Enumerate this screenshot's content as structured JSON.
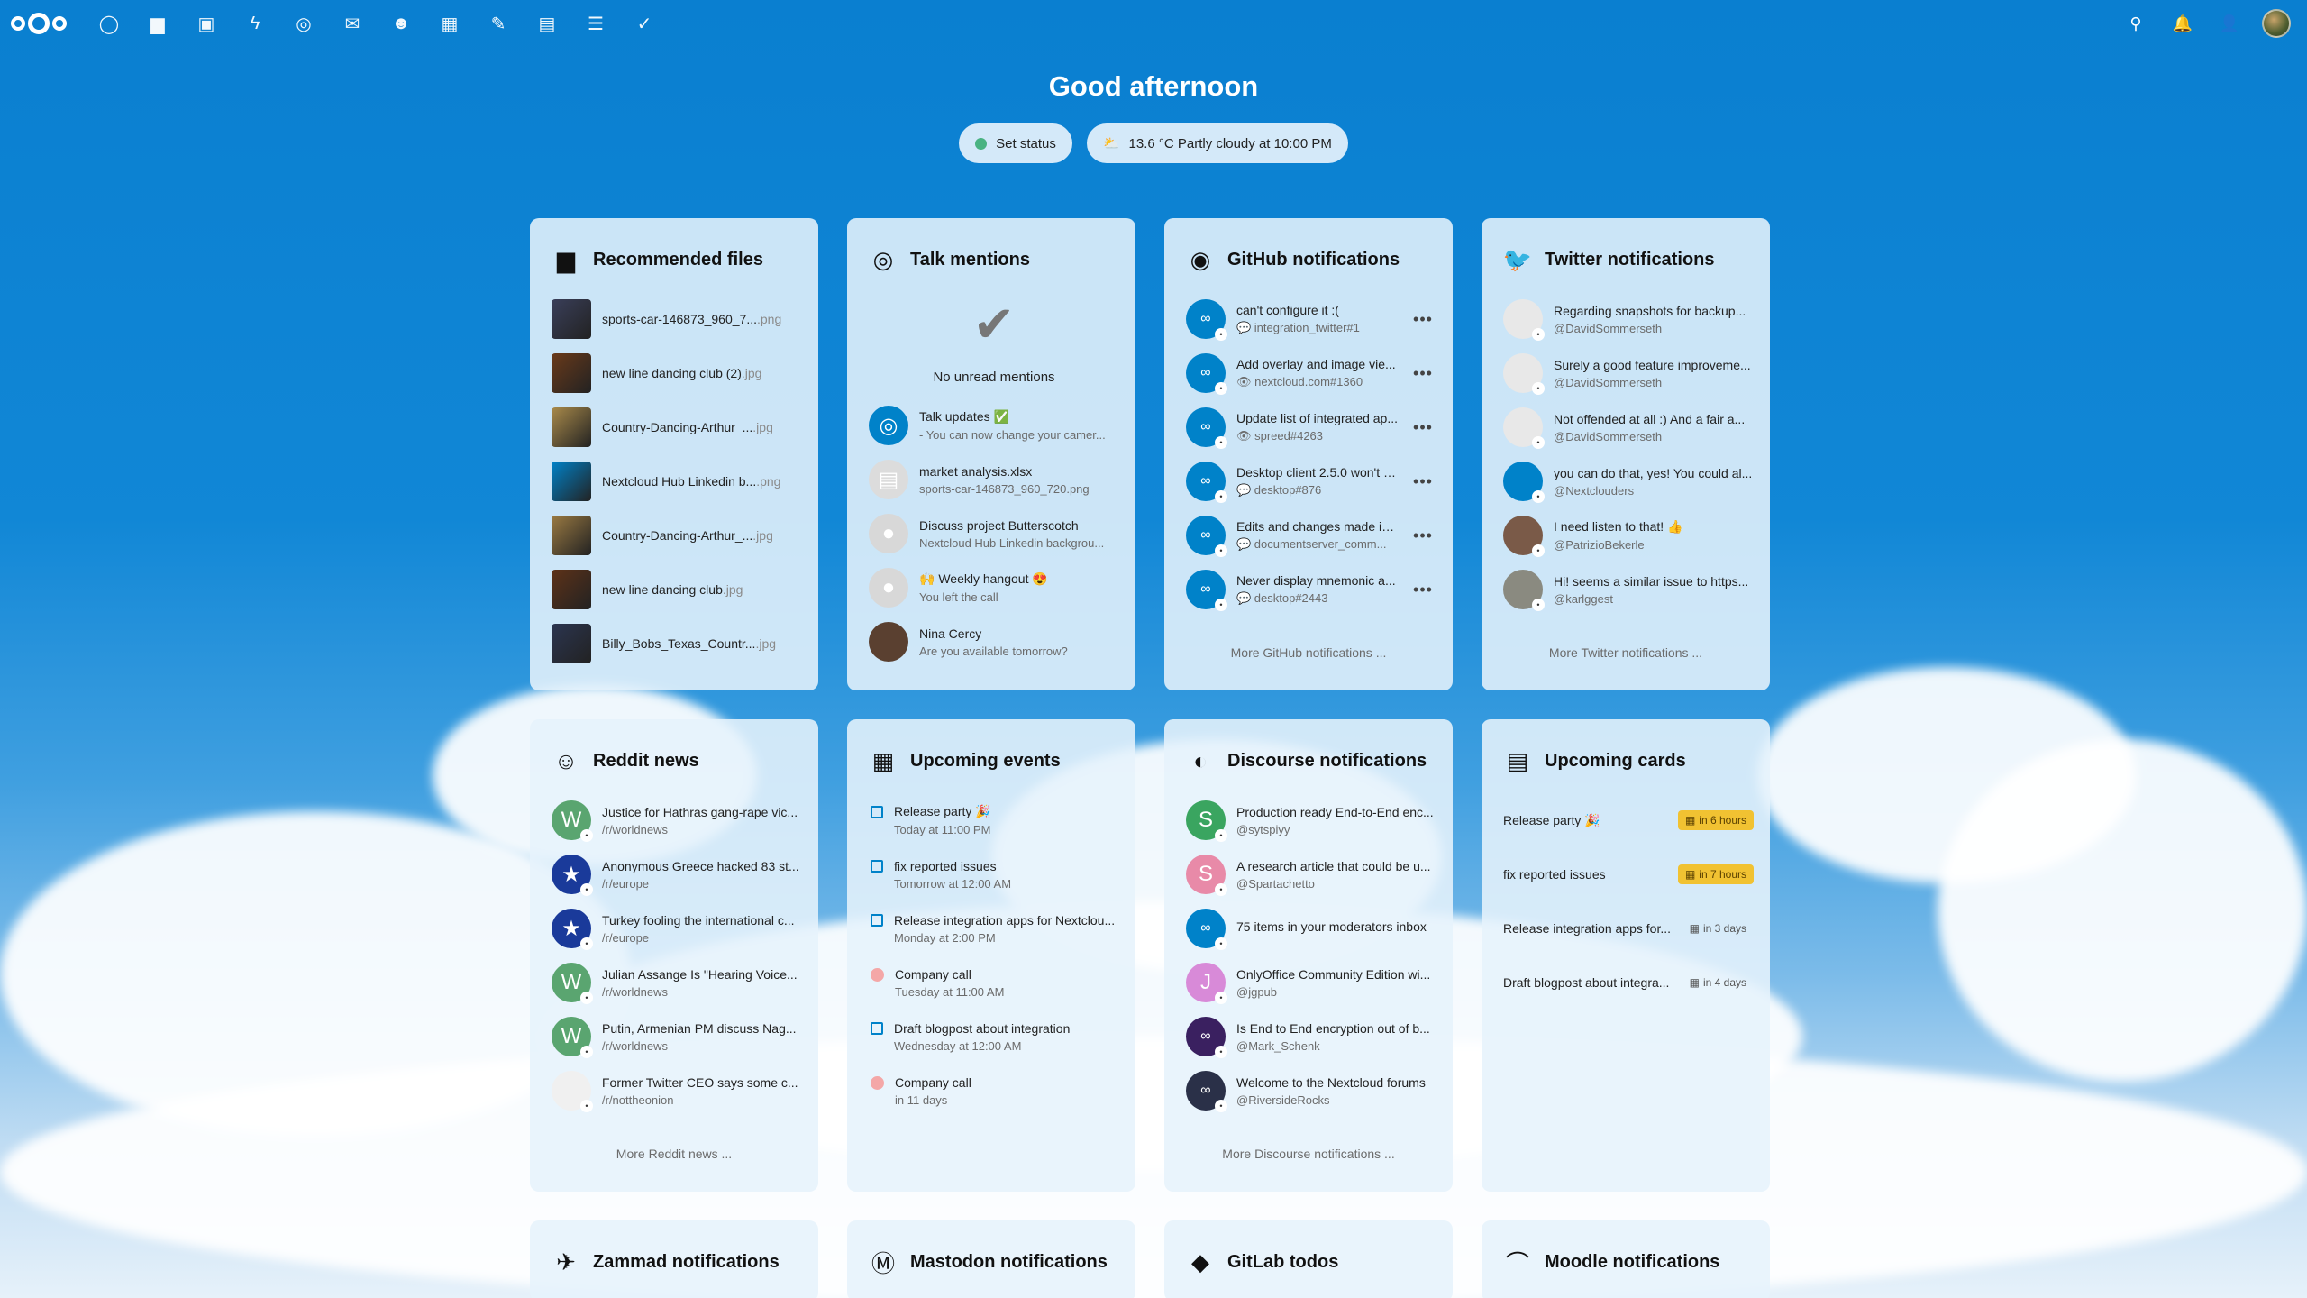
{
  "topbar": {
    "apps": [
      {
        "name": "dashboard-icon",
        "glyph": "◯"
      },
      {
        "name": "files-icon",
        "glyph": "▆"
      },
      {
        "name": "photos-icon",
        "glyph": "▣"
      },
      {
        "name": "activity-icon",
        "glyph": "ϟ"
      },
      {
        "name": "talk-icon",
        "glyph": "◎"
      },
      {
        "name": "mail-icon",
        "glyph": "✉"
      },
      {
        "name": "contacts-icon",
        "glyph": "☻"
      },
      {
        "name": "calendar-icon",
        "glyph": "▦"
      },
      {
        "name": "notes-icon",
        "glyph": "✎"
      },
      {
        "name": "deck-icon",
        "glyph": "▤"
      },
      {
        "name": "tasks-list-icon",
        "glyph": "☰"
      },
      {
        "name": "tasks-check-icon",
        "glyph": "✓"
      }
    ],
    "right": [
      {
        "name": "search-icon",
        "glyph": "⚲"
      },
      {
        "name": "notifications-icon",
        "glyph": "🔔"
      },
      {
        "name": "contacts-menu-icon",
        "glyph": "👤"
      }
    ]
  },
  "greeting": "Good afternoon",
  "status": {
    "set_status": "Set status",
    "weather": "13.6 °C Partly cloudy at 10:00 PM",
    "weather_icon": "⛅"
  },
  "recommended": {
    "title": "Recommended files",
    "items": [
      {
        "name": "sports-car-146873_960_7...",
        "ext": ".png",
        "color": "#3a3f5a"
      },
      {
        "name": "new line dancing club (2)",
        "ext": ".jpg",
        "color": "#6a3a1a"
      },
      {
        "name": "Country-Dancing-Arthur_...",
        "ext": ".jpg",
        "color": "#a98a4a"
      },
      {
        "name": "Nextcloud Hub Linkedin b...",
        "ext": ".png",
        "color": "#0082c9"
      },
      {
        "name": "Country-Dancing-Arthur_...",
        "ext": ".jpg",
        "color": "#9a7a42"
      },
      {
        "name": "new line dancing club",
        "ext": ".jpg",
        "color": "#5e3218"
      },
      {
        "name": "Billy_Bobs_Texas_Countr...",
        "ext": ".jpg",
        "color": "#2b3550"
      }
    ]
  },
  "talk": {
    "title": "Talk mentions",
    "empty": "No unread mentions",
    "items": [
      {
        "l1": "Talk updates ✅",
        "l2": "- You can now change your camer...",
        "color": "#0082c9",
        "glyph": "◎"
      },
      {
        "l1": "market analysis.xlsx",
        "l2": "sports-car-146873_960_720.png",
        "color": "#dcdcdc",
        "glyph": "▤"
      },
      {
        "l1": "Discuss project Butterscotch",
        "l2": "Nextcloud Hub Linkedin backgrou...",
        "color": "#d8d8d8",
        "glyph": "●"
      },
      {
        "l1": "🙌 Weekly hangout 😍",
        "l2": "You left the call",
        "color": "#d8d8d8",
        "glyph": "●"
      },
      {
        "l1": "Nina Cercy",
        "l2": "Are you available tomorrow?",
        "color": "#5a4030",
        "glyph": ""
      }
    ]
  },
  "github": {
    "title": "GitHub notifications",
    "more": "More GitHub notifications ...",
    "items": [
      {
        "l1": "can't configure it :(",
        "l2": "💬 integration_twitter#1"
      },
      {
        "l1": "Add overlay and image vie...",
        "l2": "👁 nextcloud.com#1360"
      },
      {
        "l1": "Update list of integrated ap...",
        "l2": "👁 spreed#4263"
      },
      {
        "l1": "Desktop client 2.5.0 won't s...",
        "l2": "💬 desktop#876"
      },
      {
        "l1": "Edits and changes made in...",
        "l2": "💬 documentserver_comm..."
      },
      {
        "l1": "Never display mnemonic a...",
        "l2": "💬 desktop#2443"
      }
    ]
  },
  "twitter": {
    "title": "Twitter notifications",
    "more": "More Twitter notifications ...",
    "items": [
      {
        "l1": "Regarding snapshots for backup...",
        "l2": "@DavidSommerseth",
        "color": "#e8e8e8"
      },
      {
        "l1": "Surely a good feature improveme...",
        "l2": "@DavidSommerseth",
        "color": "#e8e8e8"
      },
      {
        "l1": "Not offended at all :) And a fair a...",
        "l2": "@DavidSommerseth",
        "color": "#e8e8e8"
      },
      {
        "l1": "you can do that, yes! You could al...",
        "l2": "@Nextclouders",
        "color": "#0082c9"
      },
      {
        "l1": "I need listen to that! 👍",
        "l2": "@PatrizioBekerle",
        "color": "#7a5a48"
      },
      {
        "l1": "Hi! seems a similar issue to https...",
        "l2": "@karlggest",
        "color": "#8a8a80"
      }
    ]
  },
  "reddit": {
    "title": "Reddit news",
    "more": "More Reddit news ...",
    "items": [
      {
        "l1": "Justice for Hathras gang-rape vic...",
        "l2": "/r/worldnews",
        "color": "#5aa570",
        "glyph": "W"
      },
      {
        "l1": "Anonymous Greece hacked 83 st...",
        "l2": "/r/europe",
        "color": "#1a3a9a",
        "glyph": "★"
      },
      {
        "l1": "Turkey fooling the international c...",
        "l2": "/r/europe",
        "color": "#1a3a9a",
        "glyph": "★"
      },
      {
        "l1": "Julian Assange Is \"Hearing Voice...",
        "l2": "/r/worldnews",
        "color": "#5aa570",
        "glyph": "W"
      },
      {
        "l1": "Putin, Armenian PM discuss Nag...",
        "l2": "/r/worldnews",
        "color": "#5aa570",
        "glyph": "W"
      },
      {
        "l1": "Former Twitter CEO says some c...",
        "l2": "/r/nottheonion",
        "color": "#f0f0f0",
        "glyph": ""
      }
    ]
  },
  "events": {
    "title": "Upcoming events",
    "items": [
      {
        "l1": "Release party 🎉",
        "l2": "Today at 11:00 PM",
        "kind": "task"
      },
      {
        "l1": "fix reported issues",
        "l2": "Tomorrow at 12:00 AM",
        "kind": "task"
      },
      {
        "l1": "Release integration apps for Nextclou...",
        "l2": "Monday at 2:00 PM",
        "kind": "task"
      },
      {
        "l1": "Company call",
        "l2": "Tuesday at 11:00 AM",
        "kind": "event"
      },
      {
        "l1": "Draft blogpost about integration",
        "l2": "Wednesday at 12:00 AM",
        "kind": "task"
      },
      {
        "l1": "Company call",
        "l2": "in 11 days",
        "kind": "event"
      }
    ]
  },
  "discourse": {
    "title": "Discourse notifications",
    "more": "More Discourse notifications ...",
    "items": [
      {
        "l1": "Production ready End-to-End enc...",
        "l2": "@sytspiyy",
        "color": "#3aa560",
        "glyph": "S"
      },
      {
        "l1": "A research article that could be u...",
        "l2": "@Spartachetto",
        "color": "#e88aa8",
        "glyph": "S"
      },
      {
        "l1": "75 items in your moderators inbox",
        "l2": "",
        "color": "#0082c9",
        "glyph": ""
      },
      {
        "l1": "OnlyOffice Community Edition wi...",
        "l2": "@jgpub",
        "color": "#d88ad8",
        "glyph": "J"
      },
      {
        "l1": "Is End to End encryption out of b...",
        "l2": "@Mark_Schenk",
        "color": "#3a2060",
        "glyph": ""
      },
      {
        "l1": "Welcome to the Nextcloud forums",
        "l2": "@RiversideRocks",
        "color": "#2a3048",
        "glyph": ""
      }
    ]
  },
  "cards": {
    "title": "Upcoming cards",
    "items": [
      {
        "l1": "Release party 🎉",
        "due": "in 6 hours",
        "warn": true
      },
      {
        "l1": "fix reported issues",
        "due": "in 7 hours",
        "warn": true
      },
      {
        "l1": "Release integration apps for...",
        "due": "in 3 days",
        "warn": false
      },
      {
        "l1": "Draft blogpost about integra...",
        "due": "in 4 days",
        "warn": false
      }
    ]
  },
  "bottom_panels": [
    {
      "name": "zammad",
      "title": "Zammad notifications",
      "glyph": "✈"
    },
    {
      "name": "mastodon",
      "title": "Mastodon notifications",
      "glyph": "Ⓜ"
    },
    {
      "name": "gitlab",
      "title": "GitLab todos",
      "glyph": "◆"
    },
    {
      "name": "moodle",
      "title": "Moodle notifications",
      "glyph": "⌒"
    }
  ]
}
